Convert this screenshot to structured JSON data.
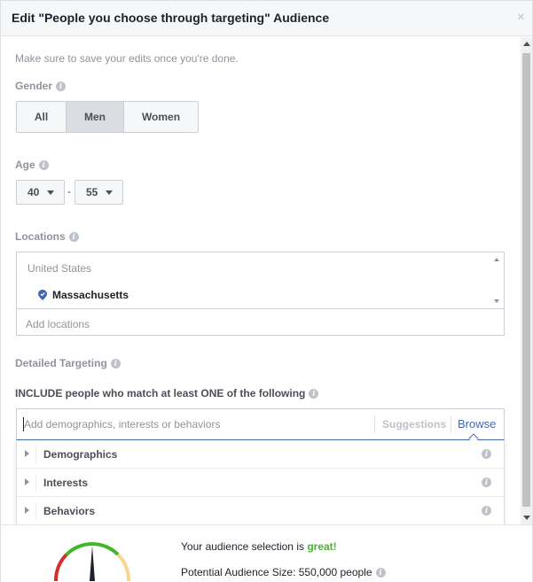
{
  "dialog": {
    "title": "Edit \"People you choose through targeting\" Audience",
    "close_label": "×"
  },
  "note": "Make sure to save your edits once you're done.",
  "gender": {
    "label": "Gender",
    "options": [
      "All",
      "Men",
      "Women"
    ],
    "selected": "Men"
  },
  "age": {
    "label": "Age",
    "min": "40",
    "separator": "-",
    "max": "55"
  },
  "locations": {
    "label": "Locations",
    "country": "United States",
    "items": [
      "Massachusetts"
    ],
    "placeholder": "Add locations"
  },
  "detailed_targeting": {
    "label": "Detailed Targeting",
    "include_label": "INCLUDE people who match at least ONE of the following",
    "search_placeholder": "Add demographics, interests or behaviors",
    "suggestions_label": "Suggestions",
    "browse_label": "Browse",
    "categories": [
      "Demographics",
      "Interests",
      "Behaviors"
    ]
  },
  "footer": {
    "selection_prefix": "Your audience selection is",
    "selection_value": "great!",
    "potential_label": "Potential Audience Size: 550,000 people"
  },
  "colors": {
    "accent": "#4267b2",
    "great": "#42b72a",
    "gauge_red": "#d0312d",
    "gauge_green": "#42b72a",
    "gauge_yellow": "#f7d68b"
  },
  "icons": [
    "close-icon",
    "info-icon",
    "chevron-down-icon",
    "location-pin-icon",
    "triangle-right-icon",
    "gauge-icon"
  ]
}
